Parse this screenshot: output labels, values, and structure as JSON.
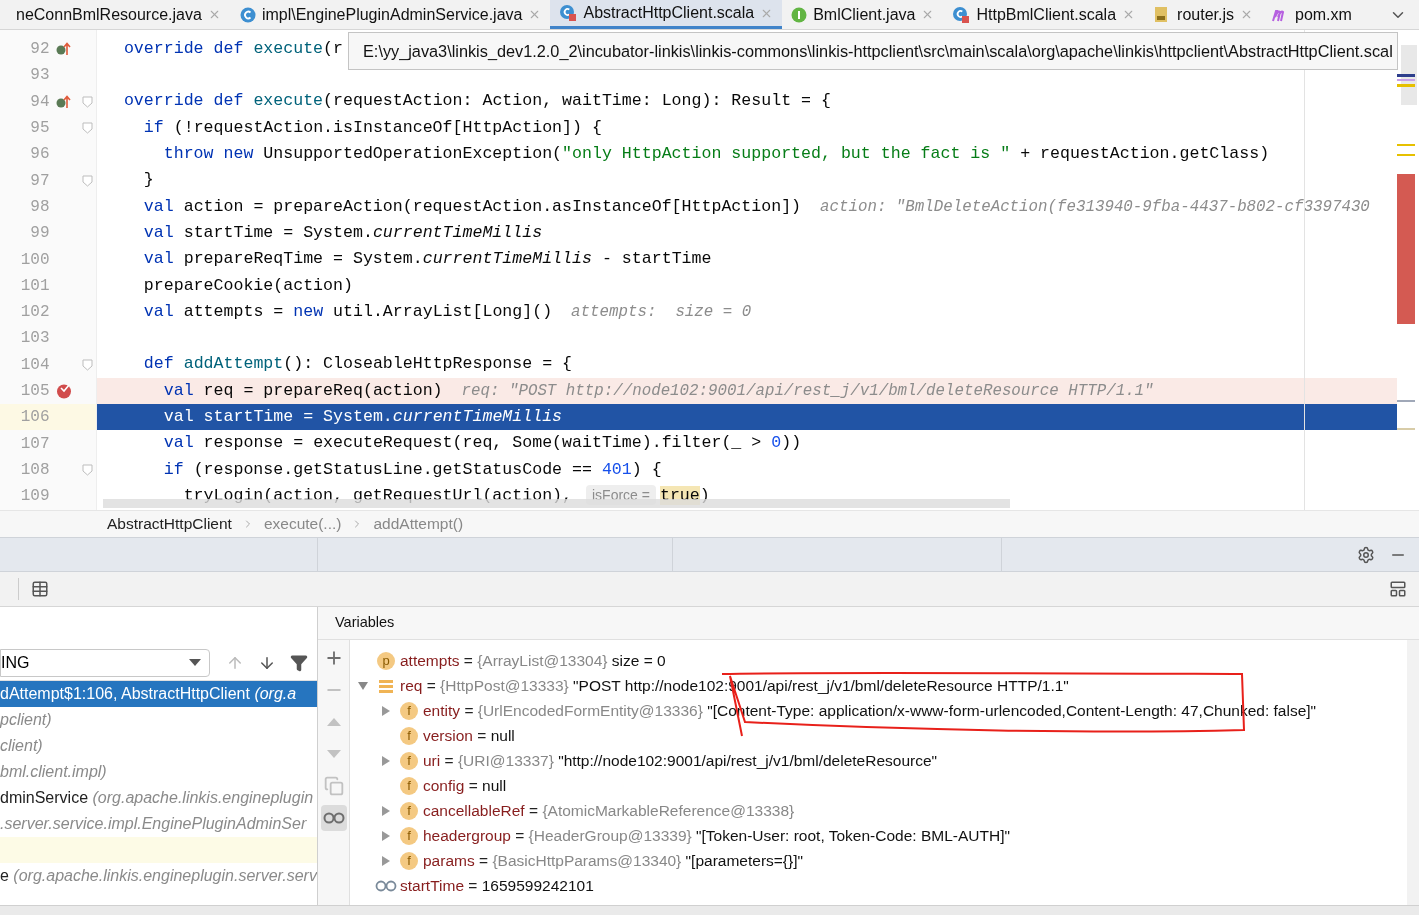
{
  "tabs": [
    {
      "label": "neConnBmlResource.java",
      "selected": false,
      "closable": true
    },
    {
      "label": "impl\\EnginePluginAdminService.java",
      "kind": "class",
      "selected": false,
      "closable": true
    },
    {
      "label": "AbstractHttpClient.scala",
      "kind": "scala",
      "selected": true,
      "closable": true
    },
    {
      "label": "BmlClient.java",
      "kind": "interface",
      "selected": false,
      "closable": true
    },
    {
      "label": "HttpBmlClient.scala",
      "kind": "scala",
      "selected": false,
      "closable": true
    },
    {
      "label": "router.js",
      "kind": "js",
      "selected": false,
      "closable": true
    },
    {
      "label": "pom.xm",
      "kind": "maven",
      "selected": false,
      "closable": false
    }
  ],
  "tooltip": "E:\\yy_java3\\linkis_dev1.2.0_2\\incubator-linkis\\linkis-commons\\linkis-httpclient\\src\\main\\scala\\org\\apache\\linkis\\httpclient\\AbstractHttpClient.scal",
  "editor": {
    "lines": [
      {
        "number": "92",
        "kind": "normal",
        "gutter": {
          "kind": "override"
        },
        "tokens": [
          {
            "kind": "kw",
            "text": "  override def "
          },
          {
            "kind": "fn",
            "text": "execute"
          },
          {
            "kind": "p",
            "text": "(r"
          }
        ]
      },
      {
        "number": "93",
        "kind": "normal"
      },
      {
        "number": "94",
        "kind": "normal",
        "gutter": {
          "kind": "override"
        },
        "fold": true,
        "tokens": [
          {
            "kind": "kw",
            "text": "  override def "
          },
          {
            "kind": "fn",
            "text": "execute"
          },
          {
            "kind": "p",
            "text": "(requestAction: Action, waitTime: Long): Result = {"
          }
        ]
      },
      {
        "number": "95",
        "kind": "normal",
        "fold": true,
        "tokens": [
          {
            "kind": "kw",
            "text": "    if "
          },
          {
            "kind": "p",
            "text": "(!requestAction.isInstanceOf[HttpAction]) {"
          }
        ]
      },
      {
        "number": "96",
        "kind": "normal",
        "tokens": [
          {
            "kind": "kw",
            "text": "      throw new "
          },
          {
            "kind": "p",
            "text": "UnsupportedOperationException("
          },
          {
            "kind": "str",
            "text": "\"only HttpAction supported, but the fact is \""
          },
          {
            "kind": "p",
            "text": " + requestAction.getClass)"
          }
        ]
      },
      {
        "number": "97",
        "kind": "normal",
        "fold": true,
        "tokens": [
          {
            "kind": "p",
            "text": "    }"
          }
        ]
      },
      {
        "number": "98",
        "kind": "normal",
        "tokens": [
          {
            "kind": "kw",
            "text": "    val "
          },
          {
            "kind": "p",
            "text": "action = prepareAction(requestAction.asInstanceOf[HttpAction])"
          },
          {
            "kind": "hint",
            "text": "  action: \"BmlDeleteAction(fe313940-9fba-4437-b802-cf3397430"
          }
        ]
      },
      {
        "number": "99",
        "kind": "normal",
        "tokens": [
          {
            "kind": "kw",
            "text": "    val "
          },
          {
            "kind": "p",
            "text": "startTime = System."
          },
          {
            "kind": "it",
            "text": "currentTimeMillis"
          }
        ]
      },
      {
        "number": "100",
        "kind": "normal",
        "tokens": [
          {
            "kind": "kw",
            "text": "    val "
          },
          {
            "kind": "p",
            "text": "prepareReqTime = System."
          },
          {
            "kind": "it",
            "text": "currentTimeMillis"
          },
          {
            "kind": "p",
            "text": " - startTime"
          }
        ]
      },
      {
        "number": "101",
        "kind": "normal",
        "tokens": [
          {
            "kind": "p",
            "text": "    prepareCookie(action)"
          }
        ]
      },
      {
        "number": "102",
        "kind": "normal",
        "tokens": [
          {
            "kind": "kw",
            "text": "    val "
          },
          {
            "kind": "p",
            "text": "attempts = "
          },
          {
            "kind": "kw",
            "text": "new "
          },
          {
            "kind": "p",
            "text": "util.ArrayList[Long]()"
          },
          {
            "kind": "hint",
            "text": "  attempts:  size = 0"
          }
        ]
      },
      {
        "number": "103",
        "kind": "normal"
      },
      {
        "number": "104",
        "kind": "normal",
        "fold": true,
        "tokens": [
          {
            "kind": "kw",
            "text": "    def "
          },
          {
            "kind": "fn",
            "text": "addAttempt"
          },
          {
            "kind": "p",
            "text": "(): CloseableHttpResponse = {"
          }
        ]
      },
      {
        "number": "105",
        "kind": "breakpoint",
        "gutter": {
          "kind": "breakpoint"
        },
        "tokens": [
          {
            "kind": "kw",
            "text": "      val "
          },
          {
            "kind": "p",
            "text": "req = prepareReq(action)"
          },
          {
            "kind": "hint",
            "text": "  req: \"POST http://node102:9001/api/rest_j/v1/bml/deleteResource HTTP/1.1\""
          }
        ]
      },
      {
        "number": "106",
        "kind": "current",
        "tokens": [
          {
            "kind": "kw",
            "text": "      val "
          },
          {
            "kind": "p",
            "text": "startTime = System."
          },
          {
            "kind": "it",
            "text": "currentTimeMillis"
          }
        ]
      },
      {
        "number": "107",
        "kind": "normal",
        "tokens": [
          {
            "kind": "kw",
            "text": "      val "
          },
          {
            "kind": "p",
            "text": "response = executeRequest(req, Some(waitTime).filter(_ > "
          },
          {
            "kind": "num",
            "text": "0"
          },
          {
            "kind": "p",
            "text": "))"
          }
        ]
      },
      {
        "number": "108",
        "kind": "normal",
        "fold": true,
        "tokens": [
          {
            "kind": "kw",
            "text": "      if "
          },
          {
            "kind": "p",
            "text": "(response.getStatusLine.getStatusCode == "
          },
          {
            "kind": "num",
            "text": "401"
          },
          {
            "kind": "p",
            "text": ") {"
          }
        ]
      },
      {
        "number": "109",
        "kind": "normal",
        "tokens": [
          {
            "kind": "p",
            "text": "        tryLogin(action, getRequestUrl(action), "
          },
          {
            "kind": "param",
            "text": "isForce ="
          },
          {
            "kind": "hl",
            "text": "true"
          },
          {
            "kind": "p",
            "text": ")"
          }
        ]
      }
    ]
  },
  "breadcrumb": [
    "AbstractHttpClient",
    "execute(...)",
    "addAttempt()"
  ],
  "frames": {
    "filter": "ING",
    "items": [
      {
        "kind": "frame",
        "name": "dAttempt$1:106, AbstractHttpClient",
        "pkg": "(org.a",
        "selected": true
      },
      {
        "kind": "frame",
        "pkg": "pclient)",
        "selected": false
      },
      {
        "kind": "frame",
        "pkg": "client)",
        "selected": false
      },
      {
        "kind": "frame",
        "pkg": "bml.client.impl)",
        "selected": false
      },
      {
        "kind": "frame",
        "name": "dminService",
        "pkg": "(org.apache.linkis.engineplugin",
        "selected": false
      },
      {
        "kind": "frame",
        "pkg": ".server.service.impl.EnginePluginAdminSer",
        "selected": false
      },
      {
        "kind": "marker",
        "selected": false
      },
      {
        "kind": "frame",
        "name": "e",
        "pkg": "(org.apache.linkis.engineplugin.server.serv",
        "selected": false
      }
    ]
  },
  "variables": {
    "title": "Variables",
    "toolbar": [
      {
        "kind": "plus",
        "disabled": false
      },
      {
        "kind": "minus",
        "disabled": true
      },
      {
        "kind": "up",
        "disabled": true
      },
      {
        "kind": "down",
        "disabled": true
      },
      {
        "kind": "copy",
        "disabled": true
      },
      {
        "kind": "glasses",
        "disabled": false,
        "on": true
      }
    ],
    "items": [
      {
        "kind": "badge",
        "badge": "p",
        "name": "attempts",
        "sep": "=",
        "type": "{ArrayList@13304}",
        "value": " size = 0",
        "expandable": false
      },
      {
        "kind": "list",
        "name": "req",
        "sep": "=",
        "type": "{HttpPost@13333}",
        "value": "\"POST http://node102:9001/api/rest_j/v1/bml/deleteResource HTTP/1.1\"",
        "expandable": true,
        "expanded": true,
        "children": [
          {
            "kind": "badge",
            "badge": "f",
            "name": "entity",
            "sep": "=",
            "type": "{UrlEncodedFormEntity@13336}",
            "value": "\"[Content-Type: application/x-www-form-urlencoded,Content-Length: 47,Chunked: false]\"",
            "expandable": true,
            "expanded": false
          },
          {
            "kind": "badge",
            "badge": "f",
            "name": "version",
            "sep": "=",
            "value": "null",
            "expandable": false
          },
          {
            "kind": "badge",
            "badge": "f",
            "name": "uri",
            "sep": "=",
            "type": "{URI@13337}",
            "value": "\"http://node102:9001/api/rest_j/v1/bml/deleteResource\"",
            "expandable": true,
            "expanded": false
          },
          {
            "kind": "badge",
            "badge": "f",
            "name": "config",
            "sep": "=",
            "value": "null",
            "expandable": false
          },
          {
            "kind": "badge",
            "badge": "f",
            "name": "cancellableRef",
            "sep": "=",
            "type": "{AtomicMarkableReference@13338}",
            "expandable": true,
            "expanded": false
          },
          {
            "kind": "badge",
            "badge": "f",
            "name": "headergroup",
            "sep": "=",
            "type": "{HeaderGroup@13339}",
            "value": "\"[Token-User: root, Token-Code: BML-AUTH]\"",
            "expandable": true,
            "expanded": false
          },
          {
            "kind": "badge",
            "badge": "f",
            "name": "params",
            "sep": "=",
            "type": "{BasicHttpParams@13340}",
            "value": "\"[parameters={}]\"",
            "expandable": true,
            "expanded": false
          }
        ]
      },
      {
        "kind": "watch",
        "name": "startTime",
        "sep": "=",
        "value": "1659599242101",
        "expandable": false
      }
    ]
  }
}
